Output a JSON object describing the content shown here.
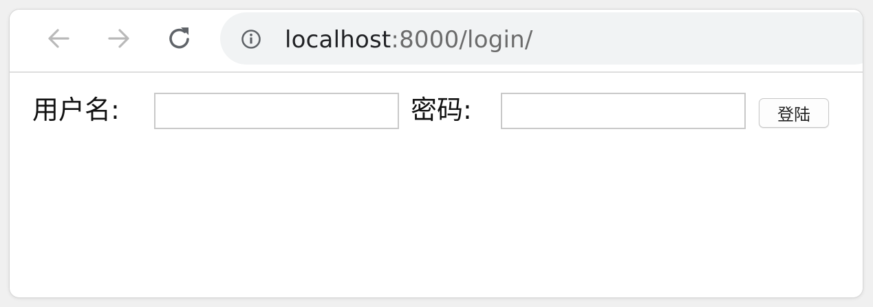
{
  "browser": {
    "address_bar": {
      "host": "localhost",
      "path": ":8000/login/"
    },
    "icons": {
      "back": "arrow-left-icon",
      "forward": "arrow-right-icon",
      "reload": "reload-icon",
      "site_info": "info-icon"
    }
  },
  "login_form": {
    "username_label": "用户名:",
    "username_value": "",
    "password_label": "密码:",
    "password_value": "",
    "submit_label": "登陆"
  }
}
